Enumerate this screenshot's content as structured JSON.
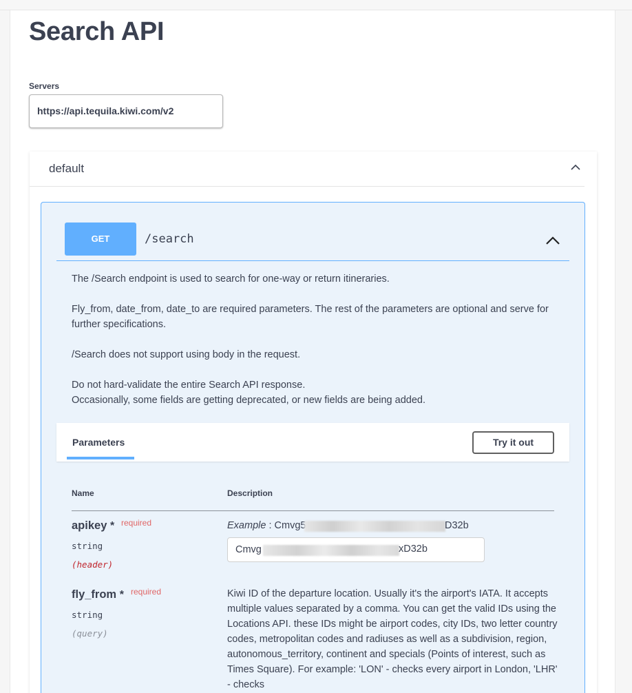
{
  "page": {
    "title": "Search API"
  },
  "servers": {
    "label": "Servers",
    "selected": "https://api.tequila.kiwi.com/v2"
  },
  "tag": {
    "name": "default"
  },
  "operation": {
    "method": "GET",
    "path": "/search",
    "description": [
      "The /Search endpoint is used to search for one-way or return itineraries.",
      "Fly_from, date_from, date_to are required parameters. The rest of the parameters are optional and serve for further specifications.",
      "/Search does not support using body in the request.",
      "Do not hard-validate the entire Search API response.",
      "Occasionally, some fields are getting deprecated, or new fields are being added."
    ]
  },
  "parameters_section": {
    "tab_label": "Parameters",
    "try_it_out_label": "Try it out",
    "col_name": "Name",
    "col_description": "Description"
  },
  "params": [
    {
      "name": "apikey",
      "required_star": "*",
      "required_label": "required",
      "type": "string",
      "in": "(header)",
      "example_label": "Example",
      "example_sep": " : ",
      "example_value_start": "Cmvg5",
      "example_value_end": "D32b",
      "input_value_start": "Cmvg",
      "input_value_end": "xD32b"
    },
    {
      "name": "fly_from",
      "required_star": "*",
      "required_label": "required",
      "type": "string",
      "in": "(query)",
      "description": "Kiwi ID of the departure location. Usually it's the airport's IATA. It accepts multiple values separated by a comma. You can get the valid IDs using the Locations API. these IDs might be airport codes, city IDs, two letter country codes, metropolitan codes and radiuses as well as a subdivision, region, autonomous_territory, continent and specials (Points of interest, such as Times Square). For example: 'LON' - checks every airport in London, 'LHR' - checks"
    }
  ],
  "colors": {
    "get_accent": "#61affe",
    "opblock_bg": "#ebf3fb",
    "required_red": "#e06666",
    "header_in_red": "#c0262d",
    "text": "#3b4151"
  },
  "icons": {
    "tag_toggle": "chevron-up-icon",
    "op_toggle": "chevron-up-icon"
  }
}
